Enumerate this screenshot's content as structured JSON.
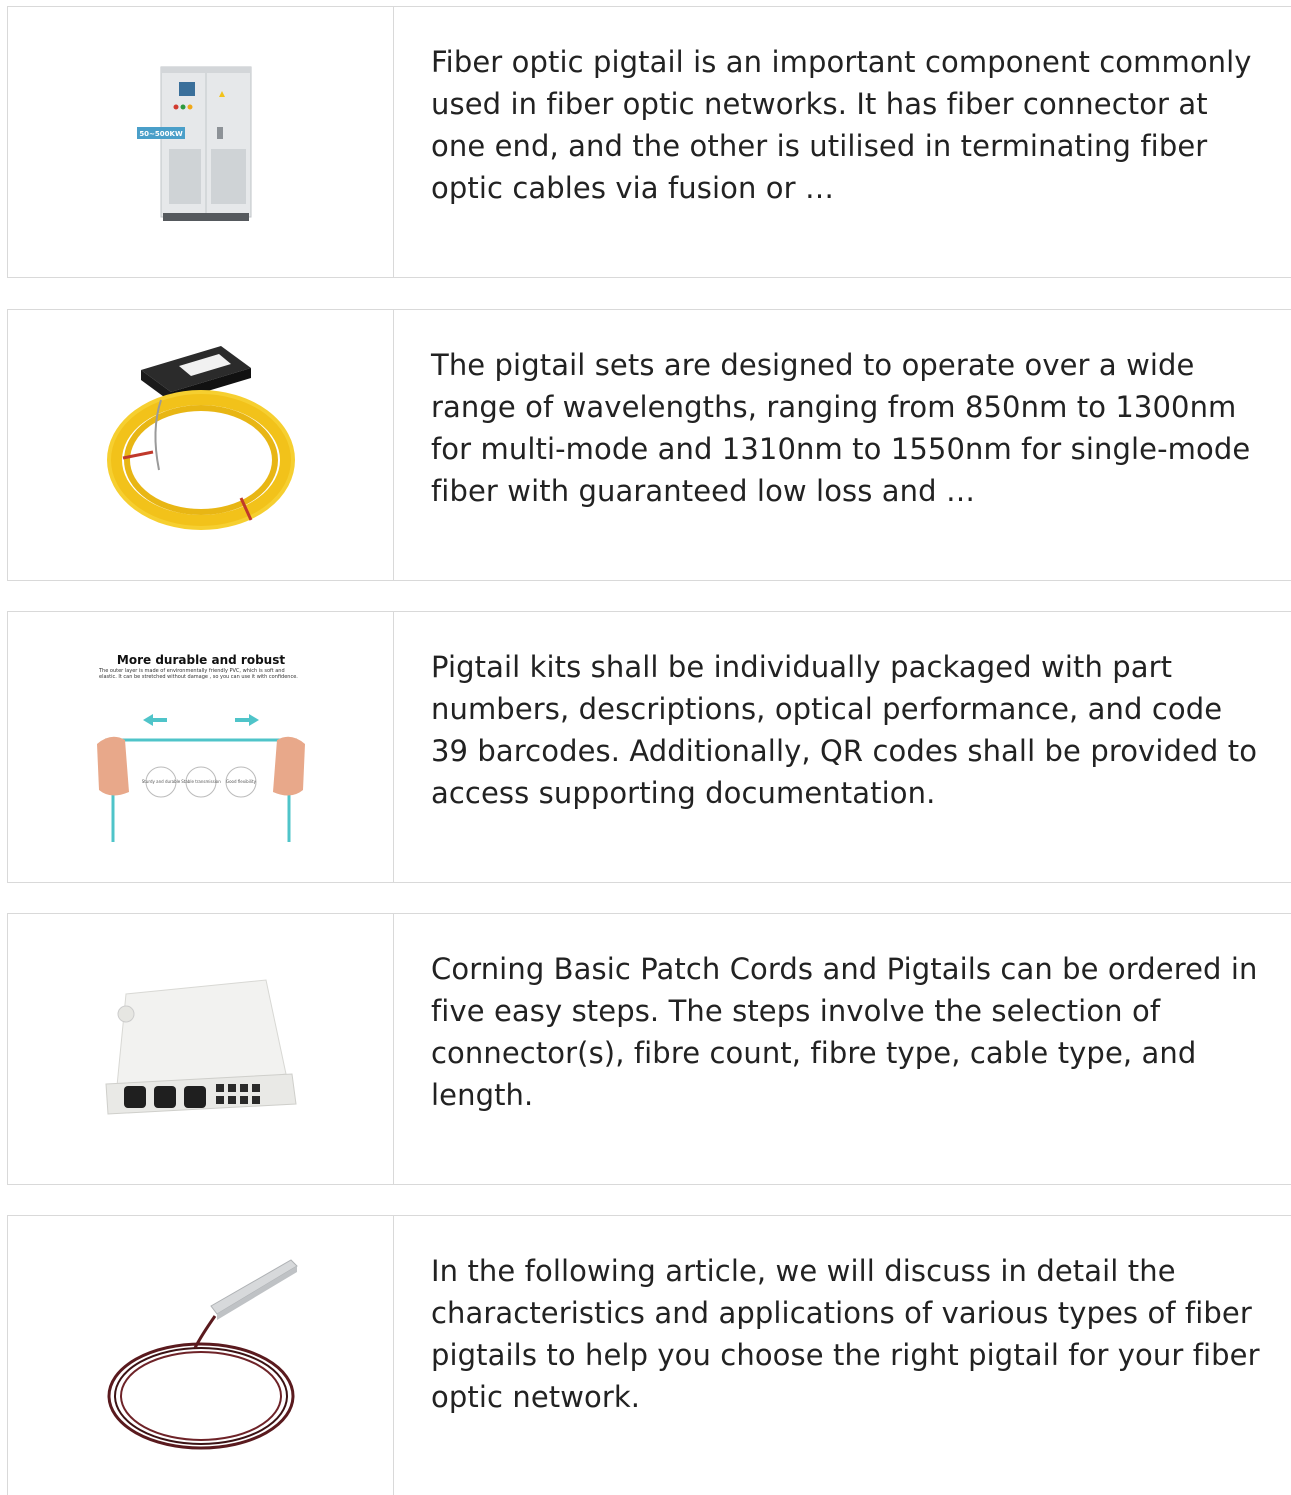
{
  "items": [
    {
      "icon": "power-cabinet-image",
      "image_badge": "50~500KW",
      "text": "Fiber optic pigtail is an important component commonly used in fiber optic networks. It has fiber connector at one end, and the other is utilised in terminating fiber optic cables via fusion or …"
    },
    {
      "icon": "fiber-spool-splitter-image",
      "text": "The pigtail sets are designed to operate over a wide range of wavelengths, ranging from 850nm to 1300nm for multi-mode and 1310nm to 1550nm for single-mode fiber with guaranteed low loss and …"
    },
    {
      "icon": "durable-cable-image",
      "image_title": "More durable and robust",
      "image_caption": "The outer layer is made of environmentally friendly PVC, which is soft and elastic. It can be stretched without damage , so you can use it with confidence.",
      "image_features": [
        "Sturdy and durable",
        "Stable transmission",
        "Good flexibility"
      ],
      "text": "Pigtail kits shall be individually packaged with part numbers, descriptions, optical performance, and code 39 barcodes. Additionally, QR codes shall be provided to access supporting documentation."
    },
    {
      "icon": "distribution-box-image",
      "text": "Corning Basic Patch Cords and Pigtails can be ordered in five easy steps. The steps involve the selection of connector(s), fibre count, fibre type, cable type, and length."
    },
    {
      "icon": "fiber-coil-image",
      "text": "In the following article, we will discuss in detail the characteristics and applications of various types of fiber pigtails to help you choose the right pigtail for your fiber optic network."
    }
  ],
  "colors": {
    "border": "#d9d9d9",
    "text": "#222222",
    "badge": "#4a9fc9",
    "cable_yellow": "#f2c21a",
    "cable_aqua": "#4fc4c9"
  }
}
